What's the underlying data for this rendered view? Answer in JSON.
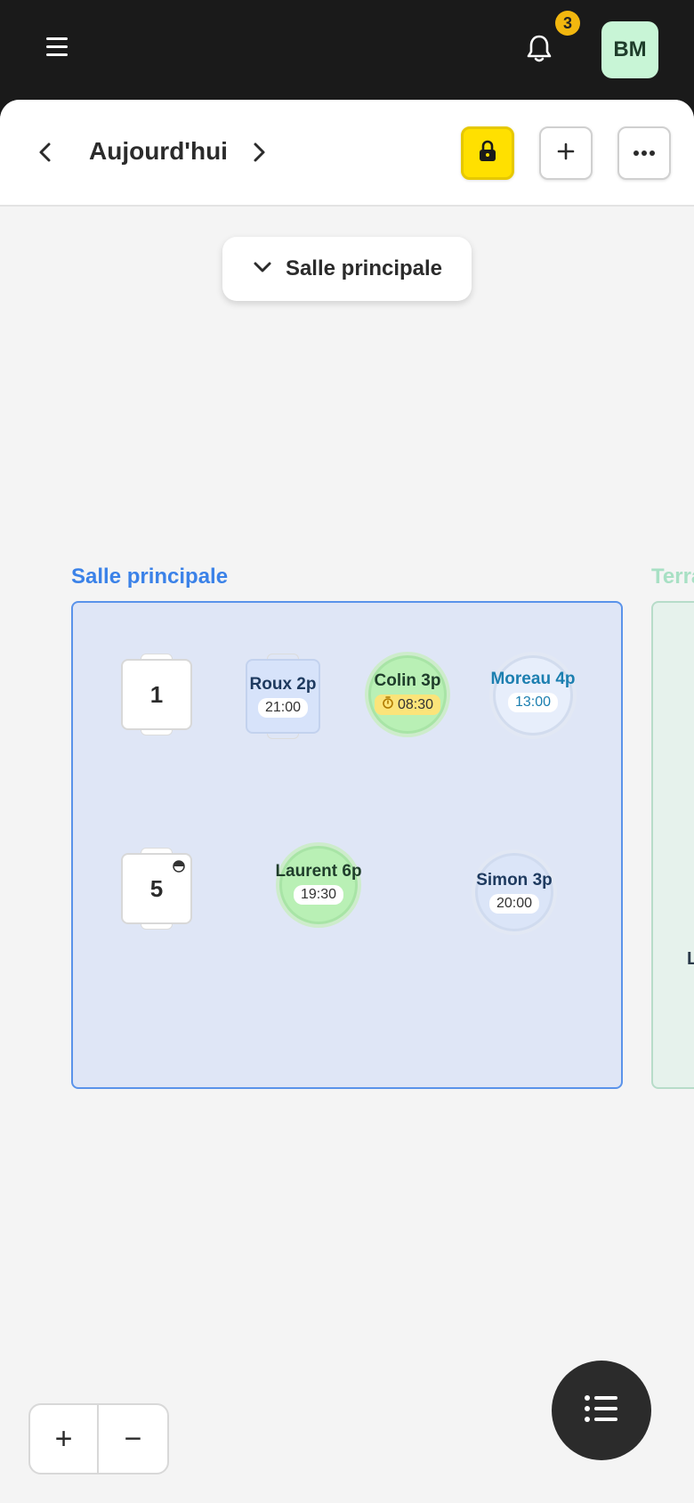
{
  "topbar": {
    "notification_count": "3",
    "avatar_initials": "BM"
  },
  "header": {
    "date_label": "Aujourd'hui"
  },
  "room_selector": {
    "selected": "Salle principale"
  },
  "rooms": [
    {
      "name": "Salle principale"
    },
    {
      "name": "Terra"
    }
  ],
  "tables": [
    {
      "label": "1"
    },
    {
      "name": "Roux 2p",
      "time": "21:00"
    },
    {
      "name": "Colin 3p",
      "time": "08:30"
    },
    {
      "name": "Moreau 4p",
      "time": "13:00"
    },
    {
      "label": "5"
    },
    {
      "name": "Laurent 6p",
      "time": "19:30"
    },
    {
      "name": "Simon 3p",
      "time": "20:00"
    }
  ],
  "room2_partial_letter": "L",
  "zoom": {
    "in": "+",
    "out": "−"
  },
  "colors": {
    "accent_yellow": "#ffe000",
    "room_blue": "#3b82e8",
    "seated_green": "#b8f0b8",
    "badge": "#f2b70f"
  }
}
